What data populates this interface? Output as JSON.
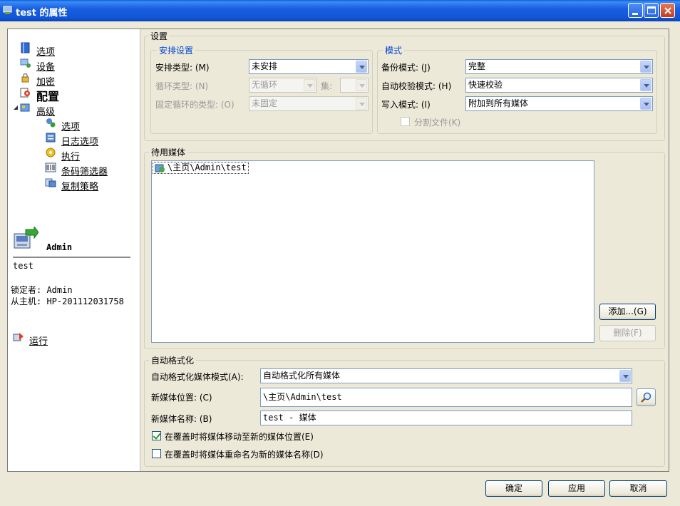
{
  "window": {
    "title": "test 的属性"
  },
  "nav": {
    "items": [
      {
        "label": "选项",
        "icon": "book-icon"
      },
      {
        "label": "设备",
        "icon": "devices-icon"
      },
      {
        "label": "加密",
        "icon": "lock-key-icon"
      },
      {
        "label": "配置",
        "icon": "config-icon"
      },
      {
        "label": "高级",
        "icon": "advanced-icon"
      }
    ],
    "subitems": [
      {
        "label": "选项",
        "icon": "options-gear-icon"
      },
      {
        "label": "日志选项",
        "icon": "log-icon"
      },
      {
        "label": "执行",
        "icon": "execute-icon"
      },
      {
        "label": "条码筛选器",
        "icon": "barcode-icon"
      },
      {
        "label": "复制策略",
        "icon": "copy-policy-icon"
      }
    ]
  },
  "info": {
    "user": "Admin",
    "job": "test",
    "locked_by": "锁定者: Admin",
    "host": "从主机: HP-201112031758",
    "run_label": "运行"
  },
  "settings": {
    "title": "设置",
    "schedule": {
      "title": "安排设置",
      "type_label": "安排类型: (M)",
      "type_value": "未安排",
      "loop_label": "循环类型: (N)",
      "loop_value": "无循环",
      "set_label": "集:",
      "fixed_label": "固定循环的类型: (O)",
      "fixed_value": "未固定"
    },
    "mode": {
      "title": "模式",
      "backup_label": "备份模式: (J)",
      "backup_value": "完整",
      "verify_label": "自动校验模式: (H)",
      "verify_value": "快速校验",
      "write_label": "写入模式: (I)",
      "write_value": "附加到所有媒体",
      "split_label": "分割文件(K)"
    }
  },
  "media": {
    "title": "待用媒体",
    "items": [
      "\\主页\\Admin\\test"
    ],
    "add_label": "添加...(G)",
    "delete_label": "删除(F)"
  },
  "autoformat": {
    "title": "自动格式化",
    "mode_label": "自动格式化媒体模式(A):",
    "mode_value": "自动格式化所有媒体",
    "location_label": "新媒体位置: (C)",
    "location_value": "\\主页\\Admin\\test",
    "name_label": "新媒体名称: (B)",
    "name_value": "test - 媒体",
    "move_label": "在覆盖时将媒体移动至新的媒体位置(E)",
    "move_checked": true,
    "rename_label": "在覆盖时将媒体重命名为新的媒体名称(D)",
    "rename_checked": false
  },
  "buttons": {
    "ok": "确定",
    "apply": "应用",
    "cancel": "取消"
  }
}
